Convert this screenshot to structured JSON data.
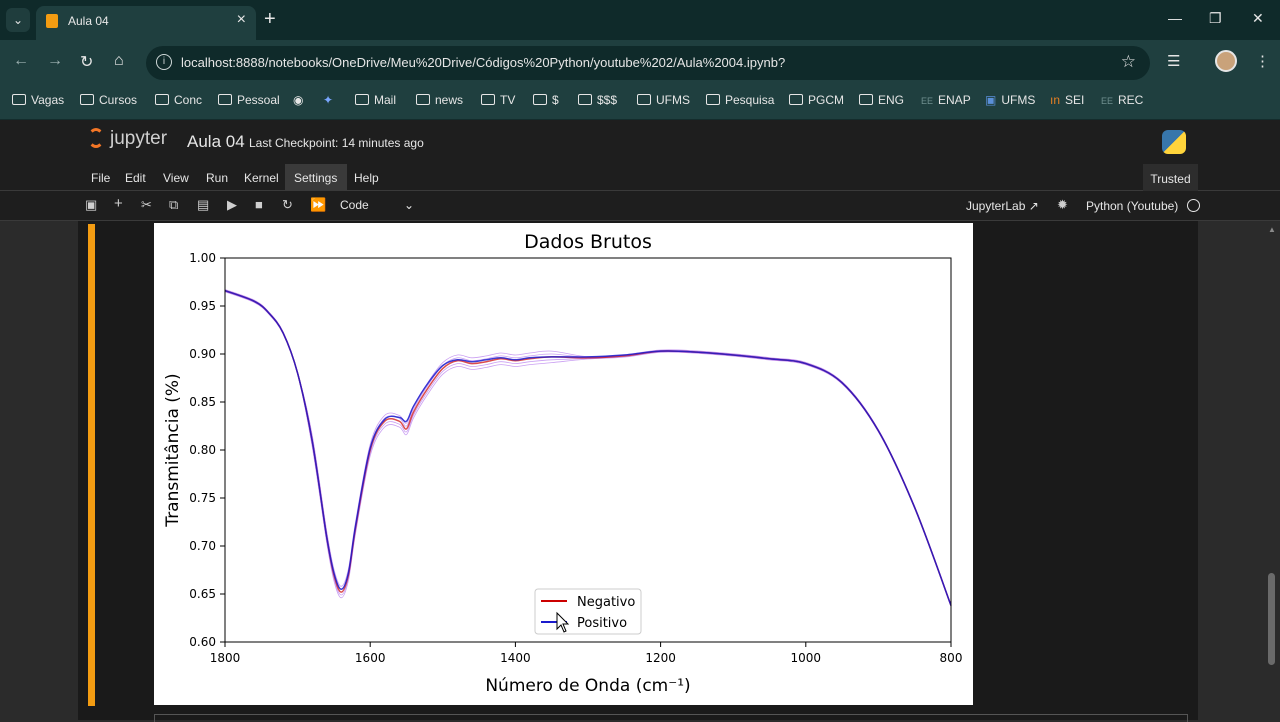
{
  "browser": {
    "tab_title": "Aula 04",
    "url": "localhost:8888/notebooks/OneDrive/Meu%20Drive/Códigos%20Python/youtube%202/Aula%2004.ipynb?",
    "bookmarks": [
      "Vagas",
      "Cursos",
      "Conc",
      "Pessoal",
      "Mail",
      "news",
      "TV",
      "$",
      "$$$",
      "UFMS",
      "Pesquisa",
      "PGCM",
      "ENG",
      "ENAP",
      "UFMS",
      "SEI",
      "REC"
    ]
  },
  "jupyter": {
    "logo_text": "jupyter",
    "notebook_title": "Aula 04",
    "checkpoint": "Last Checkpoint: 14 minutes ago",
    "menu": [
      "File",
      "Edit",
      "View",
      "Run",
      "Kernel",
      "Settings",
      "Help"
    ],
    "trusted": "Trusted",
    "cell_type": "Code",
    "jupyterlab_link": "JupyterLab",
    "kernel_name": "Python (Youtube)"
  },
  "chart_data": {
    "type": "line",
    "title": "Dados Brutos",
    "xlabel": "Número de Onda (cm⁻¹)",
    "ylabel": "Transmitância (%)",
    "xlim": [
      1800,
      800
    ],
    "ylim": [
      0.6,
      1.0
    ],
    "x_ticks": [
      "1800",
      "1600",
      "1400",
      "1200",
      "1000",
      "800"
    ],
    "y_ticks": [
      "1.00",
      "0.95",
      "0.90",
      "0.85",
      "0.80",
      "0.75",
      "0.70",
      "0.65",
      "0.60"
    ],
    "legend_location": "lower-center",
    "x": [
      1800,
      1760,
      1740,
      1720,
      1700,
      1680,
      1660,
      1650,
      1640,
      1630,
      1620,
      1600,
      1580,
      1560,
      1550,
      1540,
      1520,
      1500,
      1480,
      1460,
      1440,
      1420,
      1400,
      1380,
      1350,
      1300,
      1250,
      1200,
      1150,
      1100,
      1050,
      1000,
      950,
      900,
      850,
      800
    ],
    "series": [
      {
        "name": "Negativo",
        "color": "#cc0000",
        "values": [
          0.966,
          0.955,
          0.943,
          0.922,
          0.88,
          0.81,
          0.71,
          0.67,
          0.652,
          0.67,
          0.72,
          0.8,
          0.83,
          0.83,
          0.822,
          0.84,
          0.865,
          0.885,
          0.893,
          0.89,
          0.892,
          0.895,
          0.893,
          0.895,
          0.897,
          0.896,
          0.898,
          0.903,
          0.902,
          0.899,
          0.895,
          0.89,
          0.87,
          0.82,
          0.74,
          0.638
        ]
      },
      {
        "name": "Positivo",
        "color": "#1a1acc",
        "values": [
          0.966,
          0.955,
          0.943,
          0.922,
          0.88,
          0.81,
          0.71,
          0.672,
          0.655,
          0.672,
          0.722,
          0.802,
          0.832,
          0.834,
          0.83,
          0.846,
          0.87,
          0.888,
          0.894,
          0.892,
          0.894,
          0.896,
          0.894,
          0.896,
          0.897,
          0.897,
          0.899,
          0.903,
          0.902,
          0.899,
          0.895,
          0.89,
          0.87,
          0.82,
          0.74,
          0.638
        ]
      }
    ]
  }
}
